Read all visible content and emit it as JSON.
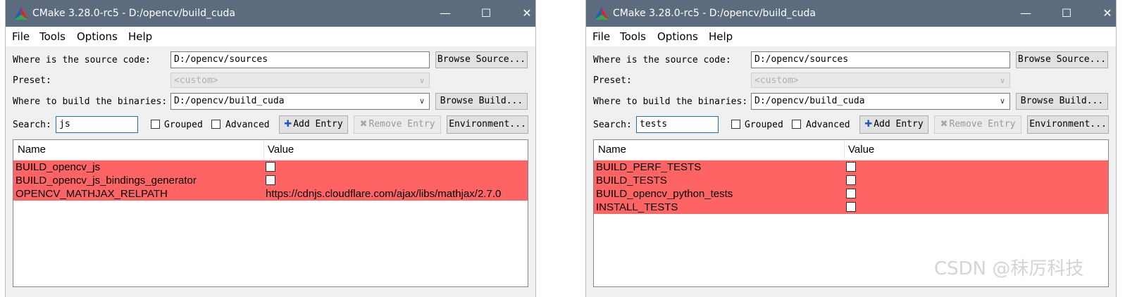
{
  "colors": {
    "titlebar": "#5d6b7e",
    "row_highlight": "#ff6464",
    "window_bg": "#f0f0f0"
  },
  "windows": [
    {
      "title": "CMake 3.28.0-rc5 - D:/opencv/build_cuda",
      "controls": {
        "minimize": "—",
        "maximize": "☐",
        "close": "✕"
      },
      "menu": [
        "File",
        "Tools",
        "Options",
        "Help"
      ],
      "source_label": "Where is the source code:",
      "source_value": "D:/opencv/sources",
      "browse_source": "Browse Source...",
      "preset_label": "Preset:",
      "preset_value": "<custom>",
      "build_label": "Where to build the binaries:",
      "build_value": "D:/opencv/build_cuda",
      "browse_build": "Browse Build...",
      "search_label": "Search:",
      "search_value": "js",
      "grouped_label": "Grouped",
      "advanced_label": "Advanced",
      "add_entry": "Add Entry",
      "remove_entry": "Remove Entry",
      "environment": "Environment...",
      "table": {
        "headers": [
          "Name",
          "Value"
        ],
        "rows": [
          {
            "name": "BUILD_opencv_js",
            "value": "",
            "checkbox": true
          },
          {
            "name": "BUILD_opencv_js_bindings_generator",
            "value": "",
            "checkbox": true
          },
          {
            "name": "OPENCV_MATHJAX_RELPATH",
            "value": "https://cdnjs.cloudflare.com/ajax/libs/mathjax/2.7.0",
            "checkbox": false
          }
        ]
      }
    },
    {
      "title": "CMake 3.28.0-rc5 - D:/opencv/build_cuda",
      "controls": {
        "minimize": "—",
        "maximize": "☐",
        "close": "✕"
      },
      "menu": [
        "File",
        "Tools",
        "Options",
        "Help"
      ],
      "source_label": "Where is the source code:",
      "source_value": "D:/opencv/sources",
      "browse_source": "Browse Source...",
      "preset_label": "Preset:",
      "preset_value": "<custom>",
      "build_label": "Where to build the binaries:",
      "build_value": "D:/opencv/build_cuda",
      "browse_build": "Browse Build...",
      "search_label": "Search:",
      "search_value": "tests",
      "grouped_label": "Grouped",
      "advanced_label": "Advanced",
      "add_entry": "Add Entry",
      "remove_entry": "Remove Entry",
      "environment": "Environment...",
      "table": {
        "headers": [
          "Name",
          "Value"
        ],
        "rows": [
          {
            "name": "BUILD_PERF_TESTS",
            "value": "",
            "checkbox": true
          },
          {
            "name": "BUILD_TESTS",
            "value": "",
            "checkbox": true
          },
          {
            "name": "BUILD_opencv_python_tests",
            "value": "",
            "checkbox": true
          },
          {
            "name": "INSTALL_TESTS",
            "value": "",
            "checkbox": true
          }
        ]
      }
    }
  ],
  "watermark": "CSDN @秣厉科技"
}
